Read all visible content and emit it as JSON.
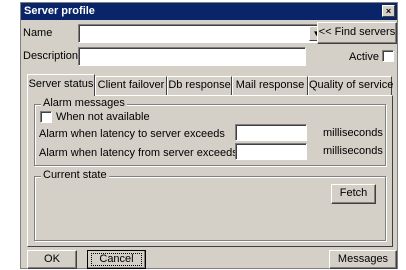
{
  "window": {
    "title": "Server profile",
    "close_glyph": "×"
  },
  "form": {
    "name_label": "Name",
    "name_value": "",
    "find_servers_label": "<< Find servers",
    "description_label": "Description",
    "description_value": "",
    "active_label": "Active",
    "active_checked": false
  },
  "tabs": [
    {
      "label": "Server status",
      "active": true
    },
    {
      "label": "Client failover",
      "active": false
    },
    {
      "label": "Db response",
      "active": false
    },
    {
      "label": "Mail response",
      "active": false
    },
    {
      "label": "Quality of service",
      "active": false
    }
  ],
  "alarm": {
    "group_title": "Alarm messages",
    "when_not_available_label": "When not available",
    "when_not_available_checked": false,
    "latency_to_label": "Alarm when latency to server exceeds",
    "latency_to_value": "",
    "latency_to_unit": "milliseconds",
    "latency_from_label": "Alarm when latency from server exceeds",
    "latency_from_value": "",
    "latency_from_unit": "milliseconds"
  },
  "current_state": {
    "group_title": "Current state",
    "fetch_label": "Fetch"
  },
  "footer": {
    "ok_label": "OK",
    "cancel_label": "Cancel",
    "messages_label": "Messages"
  },
  "colors": {
    "titlebar": "#0a246a",
    "face": "#d4d0c8"
  }
}
